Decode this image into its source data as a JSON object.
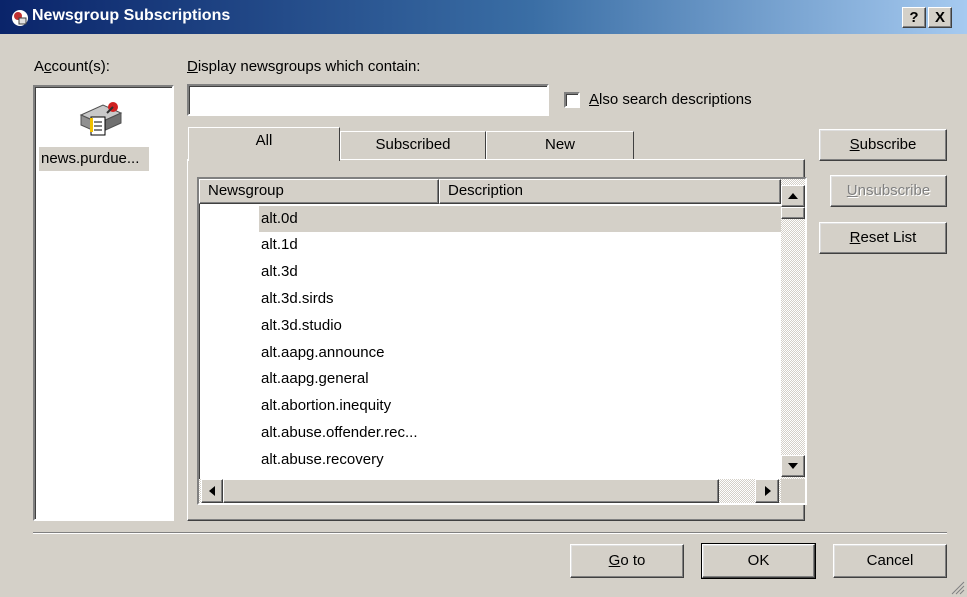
{
  "window": {
    "title": "Newsgroup Subscriptions",
    "help_button": "?",
    "close_button": "X"
  },
  "accounts": {
    "label_pre": "A",
    "label_mn": "c",
    "label_post": "count(s):",
    "items": [
      {
        "name": "news.purdue..."
      }
    ]
  },
  "search": {
    "label_mn": "D",
    "label_post": "isplay newsgroups which contain:",
    "value": "",
    "also_search_mn": "A",
    "also_search_post": "lso search descriptions",
    "also_search_checked": false
  },
  "tabs": [
    {
      "label": "All",
      "active": true
    },
    {
      "label": "Subscribed",
      "active": false
    },
    {
      "label": "New",
      "active": false
    }
  ],
  "list": {
    "columns": [
      "Newsgroup",
      "Description"
    ],
    "rows": [
      "alt.0d",
      "alt.1d",
      "alt.3d",
      "alt.3d.sirds",
      "alt.3d.studio",
      "alt.aapg.announce",
      "alt.aapg.general",
      "alt.abortion.inequity",
      "alt.abuse.offender.rec...",
      "alt.abuse.recovery"
    ],
    "selected_index": 0
  },
  "side_buttons": {
    "subscribe_mn": "S",
    "subscribe_post": "ubscribe",
    "unsubscribe_mn": "U",
    "unsubscribe_post": "nsubscribe",
    "reset_mn": "R",
    "reset_post": "eset List"
  },
  "footer": {
    "goto_mn": "G",
    "goto_post": "o to",
    "ok": "OK",
    "cancel": "Cancel"
  },
  "colors": {
    "titlebar_start": "#0a246a",
    "titlebar_end": "#a6caf0",
    "face": "#d4d0c8"
  }
}
